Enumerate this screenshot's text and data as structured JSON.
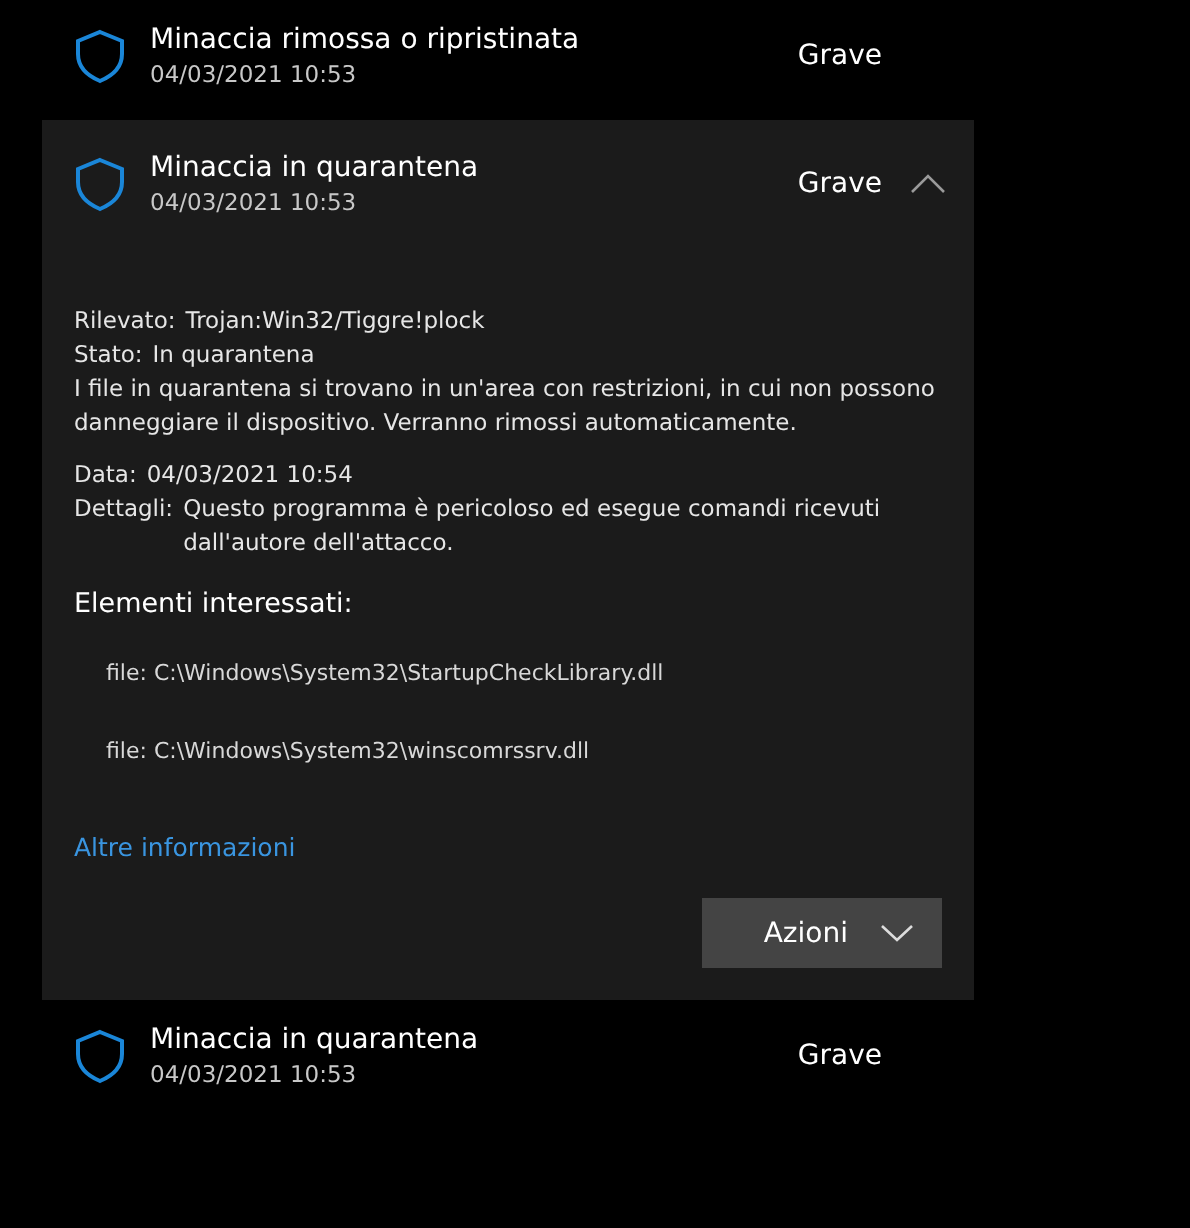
{
  "threats": [
    {
      "title": "Minaccia rimossa o ripristinata",
      "date": "04/03/2021 10:53",
      "severity": "Grave",
      "expanded": false
    },
    {
      "title": "Minaccia in quarantena",
      "date": "04/03/2021 10:53",
      "severity": "Grave",
      "expanded": true,
      "details": {
        "detected_label": "Rilevato:",
        "detected": "Trojan:Win32/Tiggre!plock",
        "status_label": "Stato:",
        "status": "In quarantena",
        "description": "I file in quarantena si trovano in un'area con restrizioni, in cui non possono danneggiare il dispositivo. Verranno rimossi automaticamente.",
        "date_label": "Data:",
        "date": "04/03/2021 10:54",
        "details_label": "Dettagli:",
        "details": "Questo programma è pericoloso ed esegue comandi ricevuti dall'autore dell'attacco.",
        "affected_title": "Elementi interessati:",
        "affected": [
          "file: C:\\Windows\\System32\\StartupCheckLibrary.dll",
          "file: C:\\Windows\\System32\\winscomrssrv.dll"
        ],
        "link": "Altre informazioni",
        "actions": "Azioni"
      }
    },
    {
      "title": "Minaccia in quarantena",
      "date": "04/03/2021 10:53",
      "severity": "Grave",
      "expanded": false
    }
  ]
}
